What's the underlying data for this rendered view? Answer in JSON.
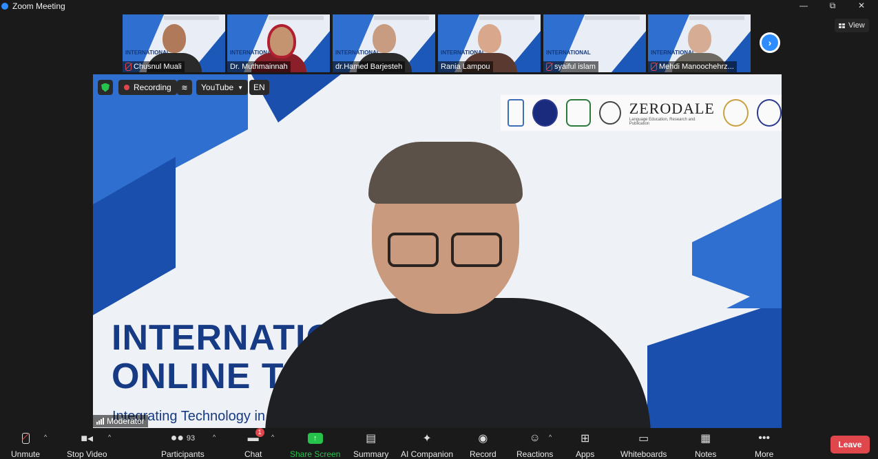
{
  "window": {
    "title": "Zoom Meeting",
    "minimize": "—",
    "restore": "⧉",
    "close": "✕"
  },
  "view": {
    "label": "View"
  },
  "participants_strip": [
    {
      "name": "Chusnul Muali",
      "muted": true
    },
    {
      "name": "Dr. Muthmainnah",
      "muted": false
    },
    {
      "name": "dr.Hamed Barjesteh",
      "muted": false
    },
    {
      "name": "Rania Lampou",
      "muted": false
    },
    {
      "name": "syaiful islam",
      "muted": true
    },
    {
      "name": "Mehdi Manoochehrz...",
      "muted": true
    }
  ],
  "next_page": {
    "glyph": "›"
  },
  "meeting_status": {
    "recording": "Recording",
    "stream": "YouTube",
    "language": "EN"
  },
  "banner": {
    "logo_text": "ZERODALE",
    "logo_subtext": "Language Education, Research and Publication",
    "title_line1": "INTERNATIONAL",
    "title_line2": "ONLINE TAL",
    "subtitle": "Integrating Technology in Eng"
  },
  "speaker": {
    "name": "Moderator"
  },
  "toolbar": {
    "unmute": "Unmute",
    "stop_video": "Stop Video",
    "participants": "Participants",
    "participants_count": "93",
    "chat": "Chat",
    "chat_badge": "1",
    "share_screen": "Share Screen",
    "summary": "Summary",
    "ai_companion": "AI Companion",
    "record": "Record",
    "reactions": "Reactions",
    "apps": "Apps",
    "whiteboards": "Whiteboards",
    "notes": "Notes",
    "more": "More",
    "leave": "Leave"
  },
  "colors": {
    "zoom_blue": "#2d8cff",
    "leave_red": "#e0474c",
    "share_green": "#27c24c",
    "banner_blue": "#163a84"
  }
}
